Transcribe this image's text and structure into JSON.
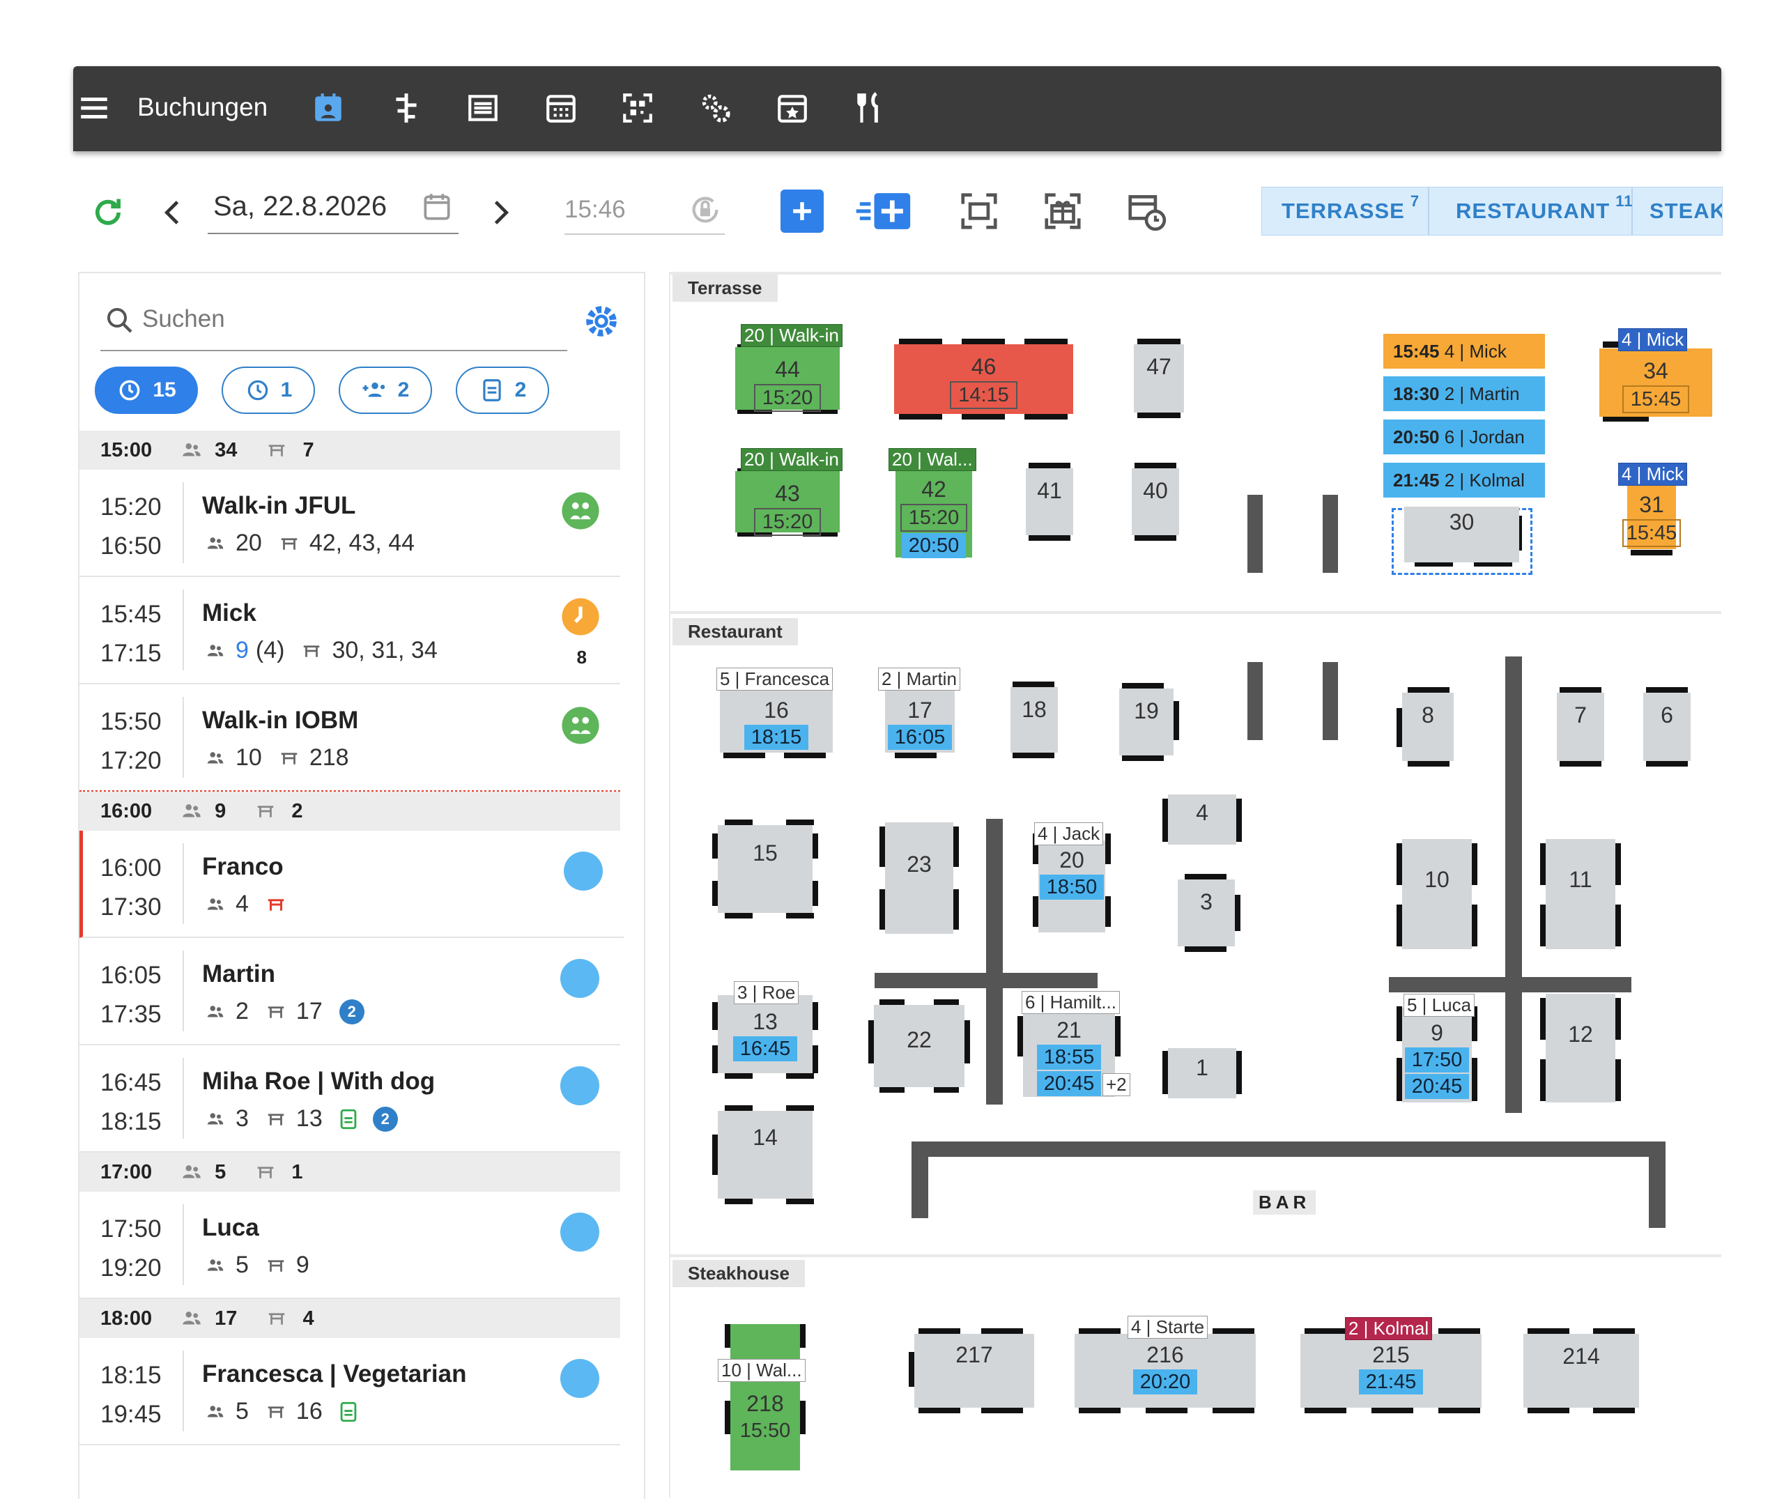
{
  "app": {
    "title": "Buchungen"
  },
  "toolbar": {
    "date": "Sa, 22.8.2026",
    "time": "15:46"
  },
  "tabs": [
    {
      "label": "TERRASSE",
      "count": "7"
    },
    {
      "label": "RESTAURANT",
      "count": "11"
    },
    {
      "label": "STEAK"
    }
  ],
  "search": {
    "placeholder": "Suchen"
  },
  "chips": [
    {
      "count": "15",
      "active": true
    },
    {
      "count": "1"
    },
    {
      "count": "2"
    },
    {
      "count": "2"
    }
  ],
  "groups": [
    {
      "time": "15:00",
      "guests": "34",
      "tables": "7"
    },
    {
      "time": "16:00",
      "guests": "9",
      "tables": "2"
    },
    {
      "time": "17:00",
      "guests": "5",
      "tables": "1"
    },
    {
      "time": "18:00",
      "guests": "17",
      "tables": "4"
    }
  ],
  "bookings": [
    {
      "start": "15:20",
      "end": "16:50",
      "name": "Walk-in JFUL",
      "guests": "20",
      "tables": "42, 43, 44"
    },
    {
      "start": "15:45",
      "end": "17:15",
      "name": "Mick",
      "guests": "9",
      "guests_extra": "(4)",
      "tables": "30, 31, 34",
      "side_count": "8"
    },
    {
      "start": "15:50",
      "end": "17:20",
      "name": "Walk-in IOBM",
      "guests": "10",
      "tables": "218"
    },
    {
      "start": "16:00",
      "end": "17:30",
      "name": "Franco",
      "guests": "4",
      "tables": ""
    },
    {
      "start": "16:05",
      "end": "17:35",
      "name": "Martin",
      "guests": "2",
      "tables": "17",
      "badge": "2"
    },
    {
      "start": "16:45",
      "end": "18:15",
      "name": "Miha Roe | With dog",
      "guests": "3",
      "tables": "13",
      "badge": "2"
    },
    {
      "start": "17:50",
      "end": "19:20",
      "name": "Luca",
      "guests": "5",
      "tables": "9"
    },
    {
      "start": "18:15",
      "end": "19:45",
      "name": "Francesca | Vegetarian",
      "guests": "5",
      "tables": "16"
    }
  ],
  "floor": {
    "sections": [
      "Terrasse",
      "Restaurant",
      "Steakhouse"
    ],
    "bar_label": "BAR",
    "reservations_list": [
      {
        "time": "15:45",
        "text": "4 | Mick",
        "color": "#f7a836"
      },
      {
        "time": "18:30",
        "text": "2 | Martin",
        "color": "#4ab3ee"
      },
      {
        "time": "20:50",
        "text": "6 | Jordan",
        "color": "#4ab3ee"
      },
      {
        "time": "21:45",
        "text": "2 | Kolmal",
        "color": "#4ab3ee"
      }
    ],
    "tables": {
      "t44": {
        "num": "44",
        "label": "20 | Walk-in",
        "time": "15:20"
      },
      "t46": {
        "num": "46",
        "time": "14:15"
      },
      "t47": {
        "num": "47"
      },
      "t34": {
        "num": "34",
        "label": "4 | Mick",
        "time": "15:45"
      },
      "t43": {
        "num": "43",
        "label": "20 | Walk-in",
        "time": "15:20"
      },
      "t42": {
        "num": "42",
        "label": "20 | Wal...",
        "time": "15:20",
        "time2": "20:50"
      },
      "t41": {
        "num": "41"
      },
      "t40": {
        "num": "40"
      },
      "t30": {
        "num": "30"
      },
      "t31": {
        "num": "31",
        "label": "4 | Mick",
        "time": "15:45"
      },
      "t16": {
        "num": "16",
        "label": "5 | Francesca",
        "time": "18:15"
      },
      "t17": {
        "num": "17",
        "label": "2 | Martin",
        "time": "16:05"
      },
      "t18": {
        "num": "18"
      },
      "t19": {
        "num": "19"
      },
      "t8": {
        "num": "8"
      },
      "t7": {
        "num": "7"
      },
      "t6": {
        "num": "6"
      },
      "t15": {
        "num": "15"
      },
      "t23": {
        "num": "23"
      },
      "t20": {
        "num": "20",
        "label": "4 | Jack",
        "time": "18:50"
      },
      "t4": {
        "num": "4"
      },
      "t3": {
        "num": "3"
      },
      "t10": {
        "num": "10"
      },
      "t11": {
        "num": "11"
      },
      "t13": {
        "num": "13",
        "label": "3 | Roe",
        "time": "16:45"
      },
      "t22": {
        "num": "22"
      },
      "t21": {
        "num": "21",
        "label": "6 | Hamilt...",
        "time": "18:55",
        "time2": "20:45",
        "more": "+2"
      },
      "t1": {
        "num": "1"
      },
      "t9": {
        "num": "9",
        "label": "5 | Luca",
        "time": "17:50",
        "time2": "20:45"
      },
      "t12": {
        "num": "12"
      },
      "t14": {
        "num": "14"
      },
      "t218": {
        "num": "218",
        "label": "10 | Wal...",
        "time": "15:50"
      },
      "t217": {
        "num": "217"
      },
      "t216": {
        "num": "216",
        "label": "4 | Starte",
        "time": "20:20"
      },
      "t215": {
        "num": "215",
        "label": "2 | Kolmal",
        "time": "21:45"
      },
      "t214": {
        "num": "214"
      }
    }
  },
  "colors": {
    "accent": "#2f80c8",
    "green": "#5eb55a",
    "red": "#e8584a",
    "orange": "#f7a836",
    "blue": "#4ab3ee"
  }
}
